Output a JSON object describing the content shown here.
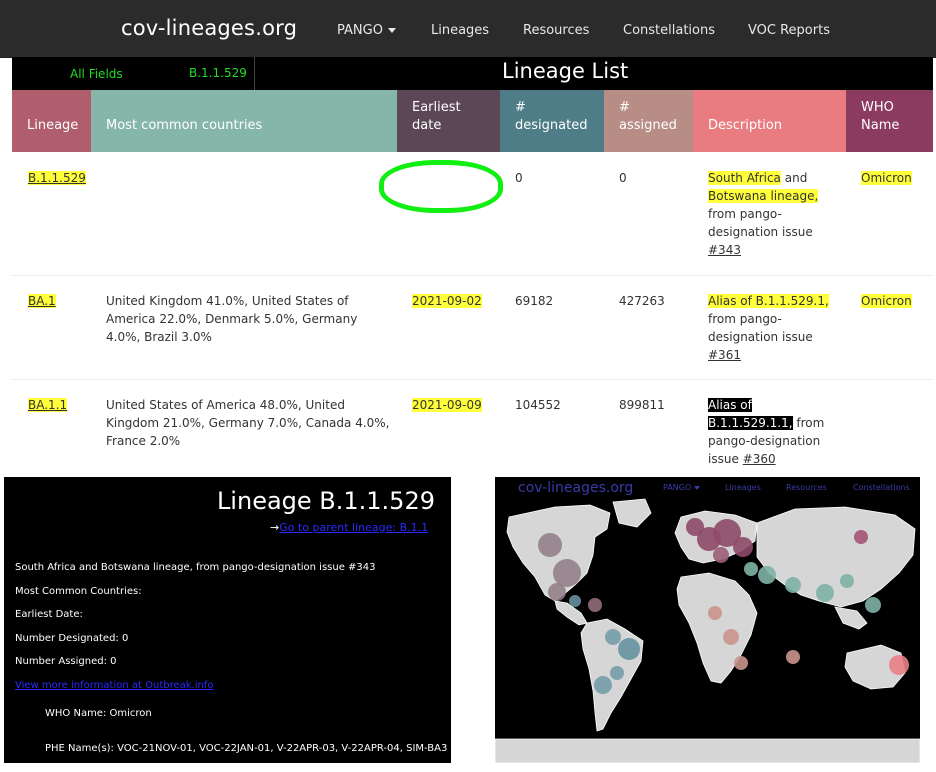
{
  "nav": {
    "brand": "cov-lineages.org",
    "items": [
      "PANGO",
      "Lineages",
      "Resources",
      "Constellations",
      "VOC Reports"
    ]
  },
  "filter": {
    "field": "All Fields",
    "value": "B.1.1.529"
  },
  "title": "Lineage List",
  "columns": [
    {
      "label": "Lineage",
      "color": "#b05e6e"
    },
    {
      "label": "Most common countries",
      "color": "#86b6a9"
    },
    {
      "label": "Earliest date",
      "color": "#5c4756"
    },
    {
      "label": "# designated",
      "color": "#4e7d88"
    },
    {
      "label": "# assigned",
      "color": "#b88d86"
    },
    {
      "label": "Description",
      "color": "#e97c80"
    },
    {
      "label": "WHO Name",
      "color": "#8b3a60"
    }
  ],
  "rows": [
    {
      "lineage": "B.1.1.529",
      "countries": "",
      "earliest": "",
      "designated": "0",
      "assigned": "0",
      "desc_hl": "South Africa",
      "desc_hl2": "Botswana lineage,",
      "desc_rest": "from pango-designation issue",
      "desc_link": "#343",
      "who": "Omicron"
    },
    {
      "lineage": "BA.1",
      "countries": "United Kingdom 41.0%, United States of America 22.0%, Denmark 5.0%, Germany 4.0%, Brazil 3.0%",
      "earliest": "2021-09-02",
      "designated": "69182",
      "assigned": "427263",
      "desc_hl": "Alias of B.1.1.529.1,",
      "desc_rest": "from pango-designation issue",
      "desc_link": "#361",
      "who": "Omicron"
    },
    {
      "lineage": "BA.1.1",
      "countries": "United States of America 48.0%, United Kingdom 21.0%, Germany 7.0%, Canada 4.0%, France 2.0%",
      "earliest": "2021-09-09",
      "designated": "104552",
      "assigned": "899811",
      "desc_hl": "Alias of B.1.1.529.1.1,",
      "desc_rest": "from pango-designation issue",
      "desc_link": "#360",
      "who": ""
    }
  ],
  "row0_and": "and",
  "detail": {
    "title": "Lineage B.1.1.529",
    "parent_arrow": "→",
    "parent_link": "Go to parent lineage: B.1.1",
    "description": "South Africa and Botswana lineage, from pango-designation issue #343",
    "most_common": "Most Common Countries:",
    "earliest": "Earliest Date:",
    "designated": "Number Designated: 0",
    "assigned": "Number Assigned: 0",
    "outbreak_link": "View more information at Outbreak.info",
    "who_name": "WHO Name: Omicron",
    "phe_names": "PHE Name(s): VOC-21NOV-01, VOC-22JAN-01, V-22APR-03, V-22APR-04, SIM-BA3"
  },
  "map": {
    "brand": "cov-lineages.org",
    "nav": [
      "PANGO",
      "Lineages",
      "Resources",
      "Constellations"
    ]
  }
}
